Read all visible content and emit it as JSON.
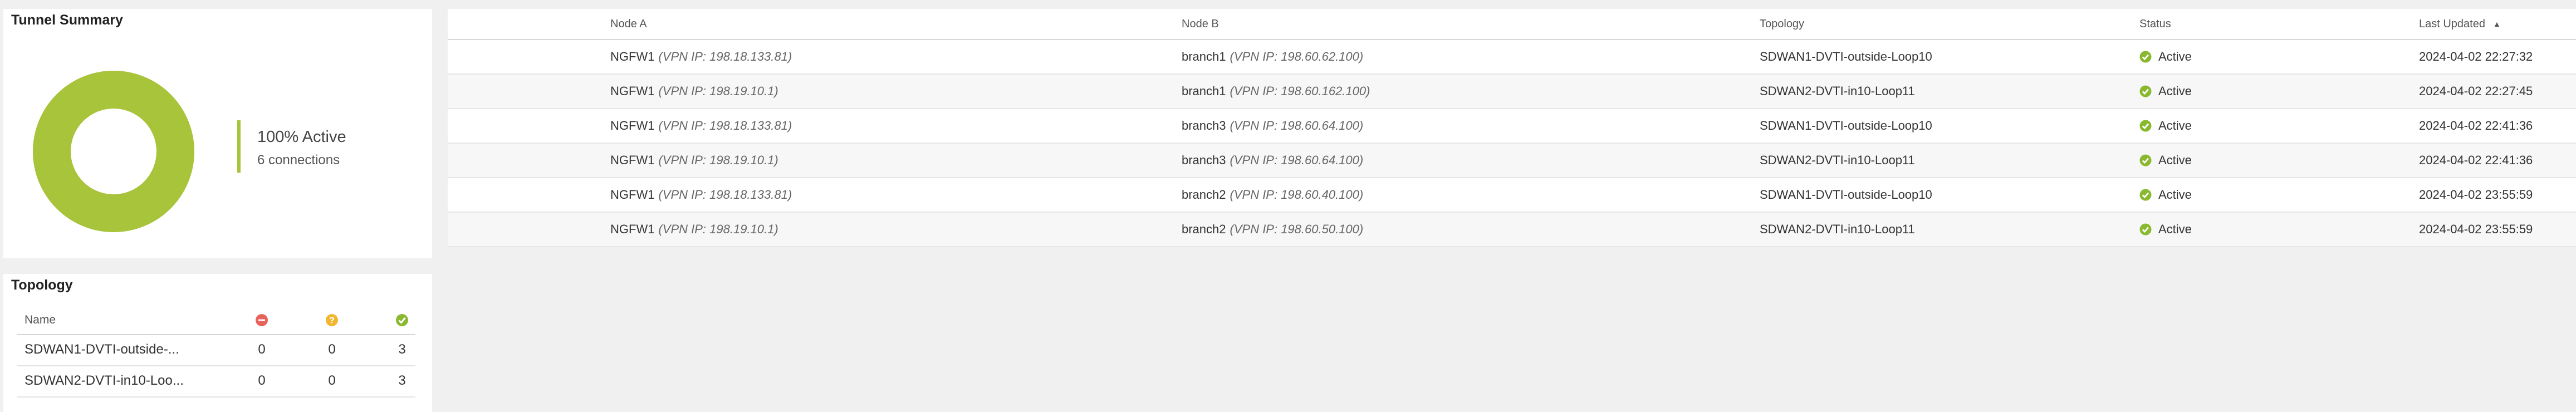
{
  "summary": {
    "title": "Tunnel Summary",
    "percent_label": "100% Active",
    "connections_label": "6 connections",
    "active_fraction": 1.0,
    "active_color": "#a8c43a"
  },
  "topology": {
    "title": "Topology",
    "columns": {
      "name": "Name",
      "down_icon": "error-icon",
      "warn_icon": "warning-icon",
      "up_icon": "check-icon"
    },
    "icon_colors": {
      "down": "#e8625a",
      "warn": "#f2b632",
      "up": "#8ab82e"
    },
    "rows": [
      {
        "name": "SDWAN1-DVTI-outside-...",
        "down": "0",
        "warn": "0",
        "up": "3"
      },
      {
        "name": "SDWAN2-DVTI-in10-Loo...",
        "down": "0",
        "warn": "0",
        "up": "3"
      }
    ]
  },
  "tunnels": {
    "headers": {
      "node_a": "Node A",
      "node_b": "Node B",
      "topology": "Topology",
      "status": "Status",
      "last_updated": "Last Updated",
      "sort_indicator": "▲"
    },
    "status_icon": "check-circle-icon",
    "status_color": "#8ab82e",
    "rows": [
      {
        "node_a": "NGFW1",
        "node_a_vpn": "(VPN IP: 198.18.133.81)",
        "node_b": "branch1",
        "node_b_vpn": "(VPN IP: 198.60.62.100)",
        "topology": "SDWAN1-DVTI-outside-Loop10",
        "status": "Active",
        "updated": "2024-04-02 22:27:32"
      },
      {
        "node_a": "NGFW1",
        "node_a_vpn": "(VPN IP: 198.19.10.1)",
        "node_b": "branch1",
        "node_b_vpn": "(VPN IP: 198.60.162.100)",
        "topology": "SDWAN2-DVTI-in10-Loop11",
        "status": "Active",
        "updated": "2024-04-02 22:27:45"
      },
      {
        "node_a": "NGFW1",
        "node_a_vpn": "(VPN IP: 198.18.133.81)",
        "node_b": "branch3",
        "node_b_vpn": "(VPN IP: 198.60.64.100)",
        "topology": "SDWAN1-DVTI-outside-Loop10",
        "status": "Active",
        "updated": "2024-04-02 22:41:36"
      },
      {
        "node_a": "NGFW1",
        "node_a_vpn": "(VPN IP: 198.19.10.1)",
        "node_b": "branch3",
        "node_b_vpn": "(VPN IP: 198.60.64.100)",
        "topology": "SDWAN2-DVTI-in10-Loop11",
        "status": "Active",
        "updated": "2024-04-02 22:41:36"
      },
      {
        "node_a": "NGFW1",
        "node_a_vpn": "(VPN IP: 198.18.133.81)",
        "node_b": "branch2",
        "node_b_vpn": "(VPN IP: 198.60.40.100)",
        "topology": "SDWAN1-DVTI-outside-Loop10",
        "status": "Active",
        "updated": "2024-04-02 23:55:59"
      },
      {
        "node_a": "NGFW1",
        "node_a_vpn": "(VPN IP: 198.19.10.1)",
        "node_b": "branch2",
        "node_b_vpn": "(VPN IP: 198.60.50.100)",
        "topology": "SDWAN2-DVTI-in10-Loop11",
        "status": "Active",
        "updated": "2024-04-02 23:55:59"
      }
    ]
  }
}
